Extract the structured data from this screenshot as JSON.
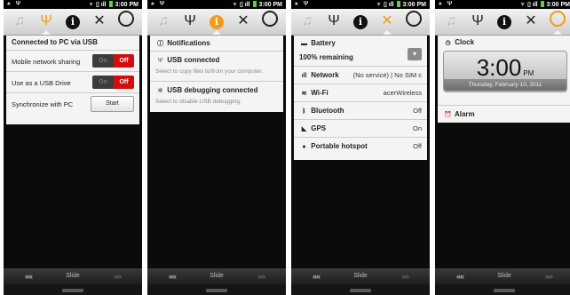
{
  "status_bar": {
    "time": "3:00 PM"
  },
  "tabs": [
    {
      "name": "music",
      "glyph": "♫"
    },
    {
      "name": "usb",
      "glyph": "Ψ"
    },
    {
      "name": "info",
      "glyph": "i"
    },
    {
      "name": "settings",
      "glyph": "✕"
    },
    {
      "name": "clock",
      "glyph": "◷"
    }
  ],
  "screens": {
    "usb": {
      "title": "Connected to PC via USB",
      "rows": [
        {
          "label": "Mobile network sharing",
          "on": "On",
          "off": "Off"
        },
        {
          "label": "Use as a USB Drive",
          "on": "On",
          "off": "Off"
        },
        {
          "label": "Synchronize with PC",
          "button": "Start"
        }
      ]
    },
    "notifications": {
      "title": "Notifications",
      "items": [
        {
          "title": "USB connected",
          "subtitle": "Select to copy files to/from your computer."
        },
        {
          "title": "USB debugging connected",
          "subtitle": "Select to disable USB debugging."
        }
      ]
    },
    "settings": {
      "battery": {
        "title": "Battery",
        "value": "100% remaining"
      },
      "rows": [
        {
          "label": "Network",
          "value": "(No service) | No SIM c",
          "icon": "signal-icon"
        },
        {
          "label": "Wi-Fi",
          "value": "acerWireless",
          "icon": "wifi-icon"
        },
        {
          "label": "Bluetooth",
          "value": "Off",
          "icon": "bluetooth-icon"
        },
        {
          "label": "GPS",
          "value": "On",
          "icon": "gps-icon"
        },
        {
          "label": "Portable hotspot",
          "value": "Off",
          "icon": "hotspot-icon"
        }
      ]
    },
    "clock": {
      "title": "Clock",
      "time": "3:00",
      "ampm": "PM",
      "date": "Thursday, February 10, 2011",
      "alarm": "Alarm"
    }
  },
  "slide_bar": {
    "left": "‹‹‹‹",
    "label": "Slide",
    "right": "››››"
  }
}
